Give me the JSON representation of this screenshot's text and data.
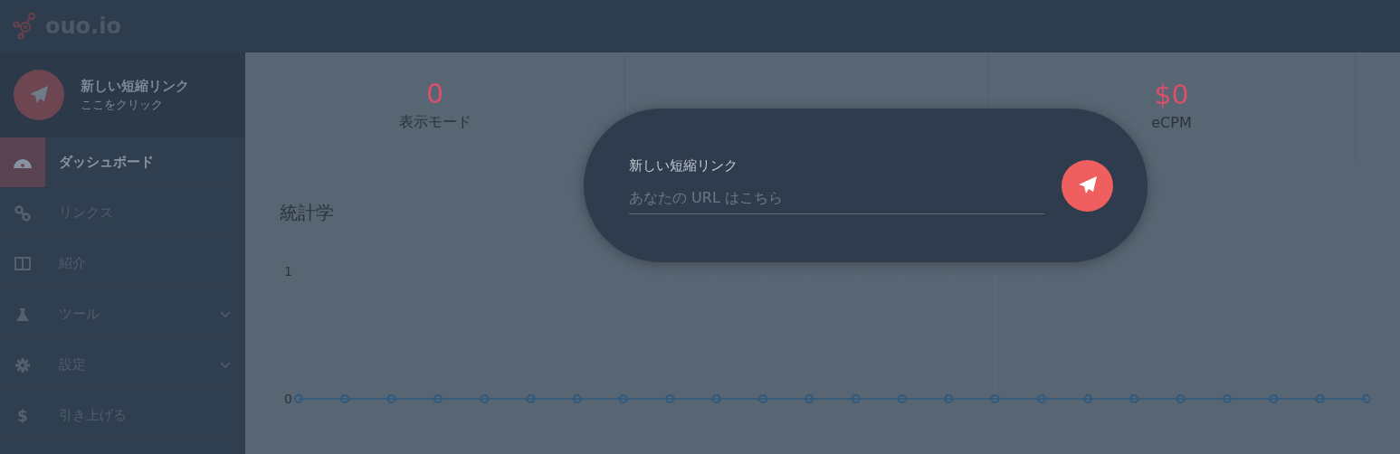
{
  "sidebar": {
    "logo": "ouo.io",
    "new_link": {
      "title": "新しい短縮リンク",
      "subtitle": "ここをクリック"
    },
    "items": [
      {
        "label": "ダッシュボード",
        "selected": true,
        "expandable": false
      },
      {
        "label": "リンクス",
        "selected": false,
        "expandable": false
      },
      {
        "label": "紹介",
        "selected": false,
        "expandable": false
      },
      {
        "label": "ツール",
        "selected": false,
        "expandable": true
      },
      {
        "label": "設定",
        "selected": false,
        "expandable": true
      },
      {
        "label": "引き上げる",
        "selected": false,
        "expandable": false,
        "glyph": "$"
      }
    ]
  },
  "stats": [
    {
      "value": "0",
      "label": "表示モード"
    },
    {
      "value": "$0",
      "label": "eCPM"
    }
  ],
  "chart": {
    "title": "統計学",
    "chart_data": {
      "type": "line",
      "yticks": [
        0,
        1
      ],
      "ylim": [
        0,
        1
      ],
      "series": [
        {
          "color": "#2f5a7e",
          "marker": "circle",
          "values": [
            0,
            0,
            0,
            0,
            0,
            0,
            0,
            0,
            0,
            0,
            0,
            0,
            0,
            0,
            0,
            0,
            0,
            0,
            0,
            0,
            0,
            0,
            0,
            0
          ]
        }
      ]
    }
  },
  "modal": {
    "label": "新しい短縮リンク",
    "placeholder": "あなたの URL はこちら"
  }
}
